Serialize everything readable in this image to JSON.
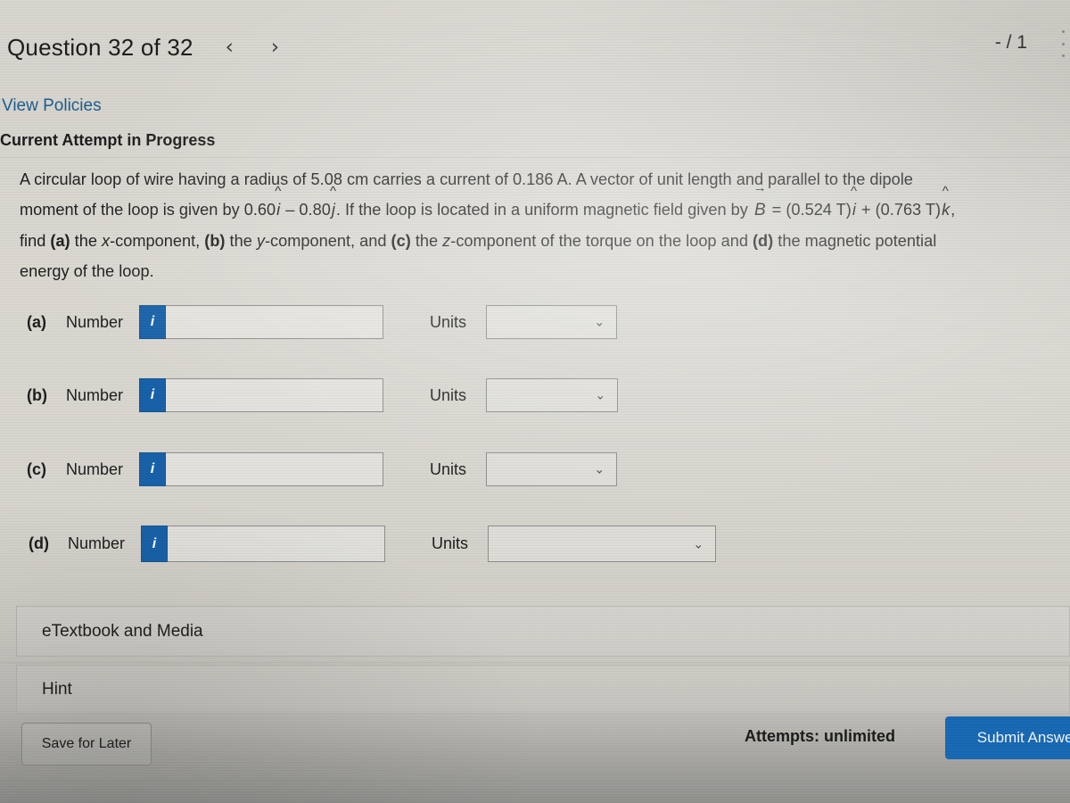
{
  "header": {
    "question_title": "Question 32 of 32",
    "prev_icon": "‹",
    "next_icon": "›",
    "score": "- / 1",
    "view_policies": "View Policies",
    "attempt_status": "Current Attempt in Progress"
  },
  "problem": {
    "line1": "A circular loop of wire having a radius of 5.08 cm carries a current of 0.186 A. A vector of unit length and parallel to the dipole",
    "line2_a": "moment of the loop is given by 0.60",
    "line2_i": "i",
    "line2_b": " – 0.80",
    "line2_j": "j",
    "line2_c": ". If the loop is located in a uniform magnetic field given by ",
    "line2_B": "B",
    "line2_d": " = (0.524 T)",
    "line2_i2": "i",
    "line2_e": " + (0.763 T)",
    "line2_k": "k",
    "line2_f": ",",
    "line3_a": "find ",
    "line3_lbl_a": "(a)",
    "line3_b": " the ",
    "line3_x": "x",
    "line3_c": "-component, ",
    "line3_lbl_b": "(b)",
    "line3_d": " the ",
    "line3_y": "y",
    "line3_e": "-component, and ",
    "line3_lbl_c": "(c)",
    "line3_f": " the ",
    "line3_z": "z",
    "line3_g": "-component of the torque on the loop and ",
    "line3_lbl_d": "(d)",
    "line3_h": " the magnetic potential",
    "line4": "energy of the loop."
  },
  "answers": {
    "number_label": "Number",
    "units_label": "Units",
    "info_icon": "i",
    "chevron_icon": "⌄",
    "rows": [
      {
        "part": "(a)",
        "value": "",
        "placeholder": "",
        "units_value": "",
        "units_placeholder": ""
      },
      {
        "part": "(b)",
        "value": "",
        "placeholder": "",
        "units_value": "",
        "units_placeholder": ""
      },
      {
        "part": "(c)",
        "value": "",
        "placeholder": "",
        "units_value": "",
        "units_placeholder": ""
      },
      {
        "part": "(d)",
        "value": "",
        "placeholder": "",
        "units_value": "",
        "units_placeholder": ""
      }
    ]
  },
  "panels": {
    "etextbook": "eTextbook and Media",
    "hint": "Hint"
  },
  "footer": {
    "save_for_later": "Save for Later",
    "attempts": "Attempts: unlimited",
    "submit_answer": "Submit Answer"
  },
  "colors": {
    "accent_blue": "#1668b3",
    "link_blue": "#1a5c8f",
    "page_bg": "#d7d5ce",
    "text": "#1d1d1d"
  }
}
